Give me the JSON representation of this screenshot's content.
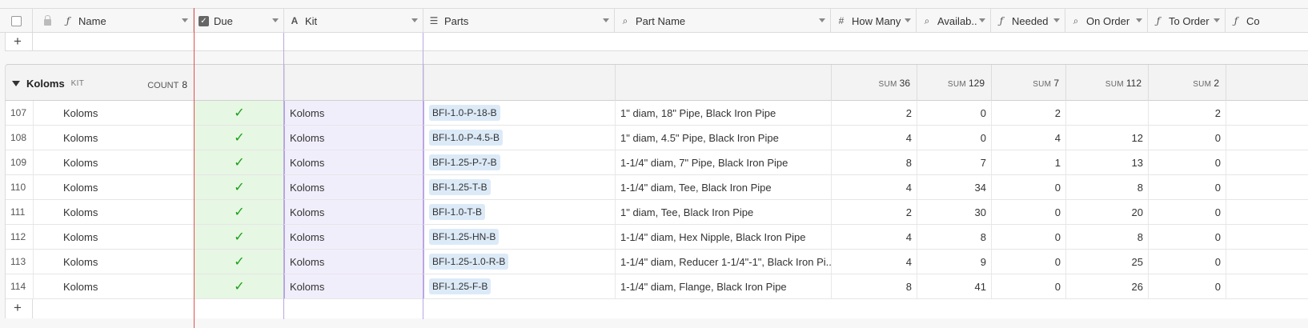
{
  "columns": [
    {
      "key": "name",
      "label": "Name",
      "icon": "formula-icon"
    },
    {
      "key": "due",
      "label": "Due",
      "icon": "checkbox-icon"
    },
    {
      "key": "kit",
      "label": "Kit",
      "icon": "text-icon"
    },
    {
      "key": "parts",
      "label": "Parts",
      "icon": "link-icon"
    },
    {
      "key": "part_name",
      "label": "Part Name",
      "icon": "lookup-icon"
    },
    {
      "key": "how_many",
      "label": "How Many",
      "icon": "number-icon"
    },
    {
      "key": "available",
      "label": "Availab..",
      "icon": "lookup-icon"
    },
    {
      "key": "needed",
      "label": "Needed",
      "icon": "formula-icon"
    },
    {
      "key": "on_order",
      "label": "On Order",
      "icon": "lookup-icon"
    },
    {
      "key": "to_order",
      "label": "To Order",
      "icon": "formula-icon"
    },
    {
      "key": "more",
      "label": "Co",
      "icon": "formula-icon"
    }
  ],
  "add_row_symbol": "+",
  "group": {
    "title": "Koloms",
    "sublabel": "KIT",
    "count_label": "COUNT",
    "count": "8",
    "sum_label": "SUM",
    "sums": {
      "how_many": "36",
      "available": "129",
      "needed": "7",
      "on_order": "112",
      "to_order": "2"
    }
  },
  "check_glyph": "✓",
  "rows": [
    {
      "id": "107",
      "name": "Koloms",
      "kit": "Koloms",
      "part": "BFI-1.0-P-18-B",
      "part_name": "1\" diam, 18\" Pipe, Black Iron Pipe",
      "how_many": "2",
      "available": "0",
      "needed": "2",
      "on_order": "",
      "to_order": "2"
    },
    {
      "id": "108",
      "name": "Koloms",
      "kit": "Koloms",
      "part": "BFI-1.0-P-4.5-B",
      "part_name": "1\" diam, 4.5\" Pipe, Black Iron Pipe",
      "how_many": "4",
      "available": "0",
      "needed": "4",
      "on_order": "12",
      "to_order": "0"
    },
    {
      "id": "109",
      "name": "Koloms",
      "kit": "Koloms",
      "part": "BFI-1.25-P-7-B",
      "part_name": "1-1/4\" diam, 7\" Pipe, Black Iron Pipe",
      "how_many": "8",
      "available": "7",
      "needed": "1",
      "on_order": "13",
      "to_order": "0"
    },
    {
      "id": "110",
      "name": "Koloms",
      "kit": "Koloms",
      "part": "BFI-1.25-T-B",
      "part_name": "1-1/4\" diam, Tee, Black Iron Pipe",
      "how_many": "4",
      "available": "34",
      "needed": "0",
      "on_order": "8",
      "to_order": "0"
    },
    {
      "id": "111",
      "name": "Koloms",
      "kit": "Koloms",
      "part": "BFI-1.0-T-B",
      "part_name": "1\" diam, Tee, Black Iron Pipe",
      "how_many": "2",
      "available": "30",
      "needed": "0",
      "on_order": "20",
      "to_order": "0"
    },
    {
      "id": "112",
      "name": "Koloms",
      "kit": "Koloms",
      "part": "BFI-1.25-HN-B",
      "part_name": "1-1/4\" diam, Hex Nipple, Black Iron Pipe",
      "how_many": "4",
      "available": "8",
      "needed": "0",
      "on_order": "8",
      "to_order": "0"
    },
    {
      "id": "113",
      "name": "Koloms",
      "kit": "Koloms",
      "part": "BFI-1.25-1.0-R-B",
      "part_name": "1-1/4\" diam, Reducer 1-1/4\"-1\", Black Iron Pi...",
      "how_many": "4",
      "available": "9",
      "needed": "0",
      "on_order": "25",
      "to_order": "0"
    },
    {
      "id": "114",
      "name": "Koloms",
      "kit": "Koloms",
      "part": "BFI-1.25-F-B",
      "part_name": "1-1/4\" diam, Flange, Black Iron Pipe",
      "how_many": "8",
      "available": "41",
      "needed": "0",
      "on_order": "26",
      "to_order": "0"
    }
  ]
}
